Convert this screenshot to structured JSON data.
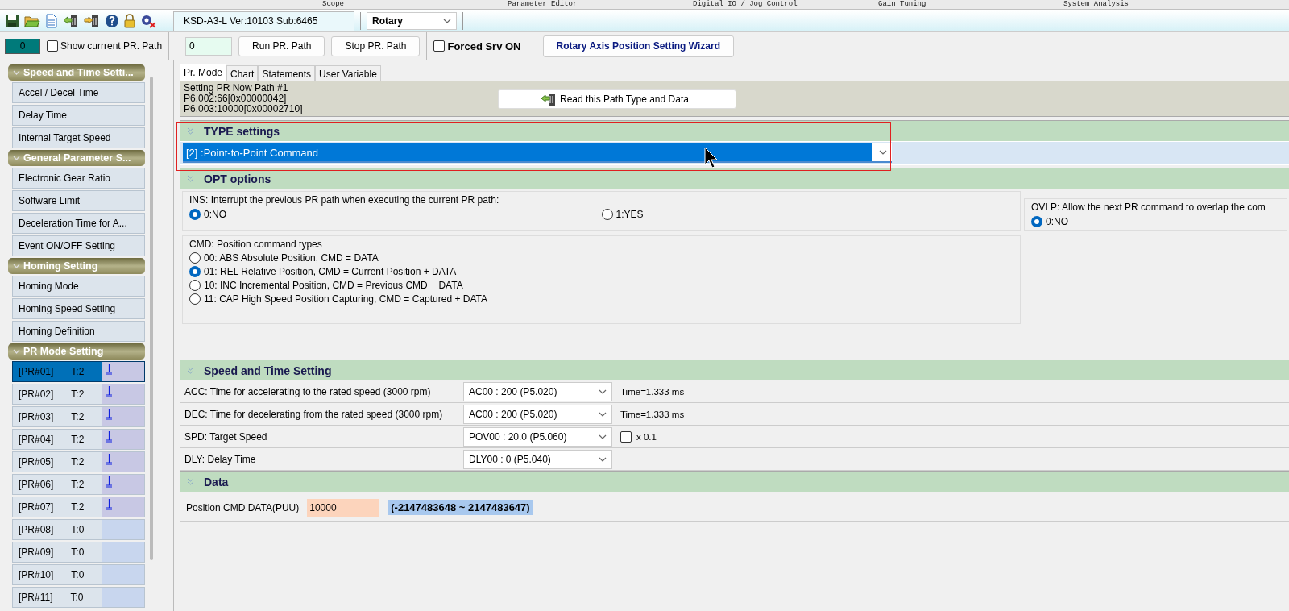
{
  "menu_tabs": [
    "Scope",
    "Parameter Editor",
    "Digital IO / Jog Control",
    "Gain Tuning",
    "System Analysis"
  ],
  "toolbar": {
    "version": "KSD-A3-L Ver:10103 Sub:6465",
    "mode_select": "Rotary"
  },
  "controls": {
    "pr_number": "0",
    "show_current_path": {
      "label": "Show currrent PR. Path",
      "checked": false
    },
    "path_input": "0",
    "run_button": "Run PR. Path",
    "stop_button": "Stop PR. Path",
    "forced_servo": {
      "label": "Forced Srv ON",
      "checked": false
    },
    "wizard_button": "Rotary Axis Position Setting Wizard"
  },
  "sidebar": {
    "groups": [
      {
        "title": "Speed and Time Setti...",
        "items": [
          {
            "kind": "link",
            "label": "Accel / Decel Time"
          },
          {
            "kind": "link",
            "label": "Delay Time"
          },
          {
            "kind": "link",
            "label": "Internal Target Speed"
          }
        ]
      },
      {
        "title": "General Parameter S...",
        "items": [
          {
            "kind": "link",
            "label": "Electronic Gear Ratio"
          },
          {
            "kind": "link",
            "label": "Software Limit"
          },
          {
            "kind": "link",
            "label": "Deceleration Time for A..."
          },
          {
            "kind": "link",
            "label": "Event ON/OFF Setting"
          }
        ]
      },
      {
        "title": "Homing Setting",
        "items": [
          {
            "kind": "link",
            "label": "Homing Mode"
          },
          {
            "kind": "link",
            "label": "Homing Speed Setting"
          },
          {
            "kind": "link",
            "label": "Homing Definition"
          }
        ]
      },
      {
        "title": "PR Mode Setting",
        "items": [
          {
            "kind": "pr",
            "label": "[PR#01]",
            "type": "T:2",
            "selected": true,
            "has_path": true
          },
          {
            "kind": "pr",
            "label": "[PR#02]",
            "type": "T:2",
            "selected": false,
            "has_path": true
          },
          {
            "kind": "pr",
            "label": "[PR#03]",
            "type": "T:2",
            "selected": false,
            "has_path": true
          },
          {
            "kind": "pr",
            "label": "[PR#04]",
            "type": "T:2",
            "selected": false,
            "has_path": true
          },
          {
            "kind": "pr",
            "label": "[PR#05]",
            "type": "T:2",
            "selected": false,
            "has_path": true
          },
          {
            "kind": "pr",
            "label": "[PR#06]",
            "type": "T:2",
            "selected": false,
            "has_path": true
          },
          {
            "kind": "pr",
            "label": "[PR#07]",
            "type": "T:2",
            "selected": false,
            "has_path": true
          },
          {
            "kind": "pr",
            "label": "[PR#08]",
            "type": "T:0",
            "selected": false,
            "has_path": false
          },
          {
            "kind": "pr",
            "label": "[PR#09]",
            "type": "T:0",
            "selected": false,
            "has_path": false
          },
          {
            "kind": "pr",
            "label": "[PR#10]",
            "type": "T:0",
            "selected": false,
            "has_path": false
          },
          {
            "kind": "pr",
            "label": "[PR#11]",
            "type": "T:0",
            "selected": false,
            "has_path": false
          }
        ]
      }
    ]
  },
  "tabs": [
    {
      "label": "Pr. Mode",
      "selected": true
    },
    {
      "label": "Chart",
      "selected": false
    },
    {
      "label": "Statements",
      "selected": false
    },
    {
      "label": "User Variable",
      "selected": false
    }
  ],
  "info": {
    "lines": [
      "Setting PR Now Path #1",
      "P6.002:66[0x00000042]",
      "P6.003:10000[0x00002710]"
    ],
    "read_button": "Read this Path Type and Data"
  },
  "type_settings": {
    "title": "TYPE settings",
    "value": "[2] :Point-to-Point Command",
    "highlighted": true
  },
  "opt_options": {
    "title": "OPT options",
    "ins": {
      "label": "INS: Interrupt the previous PR path when executing the current PR path:",
      "options": [
        {
          "label": "0:NO",
          "selected": true
        },
        {
          "label": "1:YES",
          "selected": false
        }
      ]
    },
    "ovlp": {
      "label": "OVLP: Allow the next PR command to overlap the com",
      "options": [
        {
          "label": "0:NO",
          "selected": true
        }
      ]
    },
    "cmd": {
      "label": "CMD: Position command types",
      "options": [
        {
          "label": "00: ABS Absolute Position, CMD = DATA",
          "selected": false
        },
        {
          "label": "01: REL Relative Position, CMD = Current Position + DATA",
          "selected": true
        },
        {
          "label": "10: INC Incremental Position, CMD = Previous CMD + DATA",
          "selected": false
        },
        {
          "label": "11: CAP High Speed Position Capturing, CMD = Captured + DATA",
          "selected": false
        }
      ]
    }
  },
  "speed_time": {
    "title": "Speed and Time Setting",
    "rows": [
      {
        "kind": "time",
        "label": "ACC: Time for accelerating to the rated speed (3000 rpm)",
        "value": "AC00 : 200 (P5.020)",
        "note": "Time=1.333 ms"
      },
      {
        "kind": "time",
        "label": "DEC: Time for decelerating from the rated speed (3000 rpm)",
        "value": "AC00 : 200 (P5.020)",
        "note": "Time=1.333 ms"
      },
      {
        "kind": "checkbox",
        "label": "SPD: Target Speed",
        "value": "POV00 : 20.0 (P5.060)",
        "note": "x 0.1",
        "checked": false
      },
      {
        "kind": "plain",
        "label": "DLY: Delay Time",
        "value": "DLY00 : 0 (P5.040)"
      }
    ]
  },
  "data": {
    "title": "Data",
    "label": "Position CMD DATA(PUU)",
    "value": "10000",
    "range": "(-2147483648 ~ 2147483647)"
  }
}
